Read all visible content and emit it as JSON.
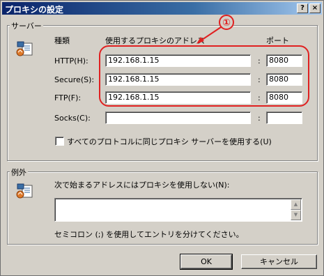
{
  "window": {
    "title": "プロキシの設定",
    "help_btn": "?",
    "close_btn": "×"
  },
  "servers": {
    "group_label": "サーバー",
    "col_type": "種類",
    "col_address": "使用するプロキシのアドレス",
    "col_port": "ポート",
    "rows": [
      {
        "label": "HTTP(H):",
        "address": "192.168.1.15",
        "port": "8080"
      },
      {
        "label": "Secure(S):",
        "address": "192.168.1.15",
        "port": "8080"
      },
      {
        "label": "FTP(F):",
        "address": "192.168.1.15",
        "port": "8080"
      },
      {
        "label": "Socks(C):",
        "address": "",
        "port": ""
      }
    ],
    "colon": ":",
    "same_proxy_label": "すべてのプロトコルに同じプロキシ サーバーを使用する(U)",
    "same_proxy_checked": false
  },
  "exceptions": {
    "group_label": "例外",
    "instruction": "次で始まるアドレスにはプロキシを使用しない(N):",
    "value": "",
    "hint": "セミコロン (;) を使用してエントリを分けてください。"
  },
  "buttons": {
    "ok": "OK",
    "cancel": "キャンセル"
  },
  "annotation": {
    "number": "①",
    "color": "#e02020"
  },
  "icons": {
    "servers": "network-computer-icon",
    "exceptions": "network-computer-icon",
    "arrow": "arrow-icon"
  }
}
